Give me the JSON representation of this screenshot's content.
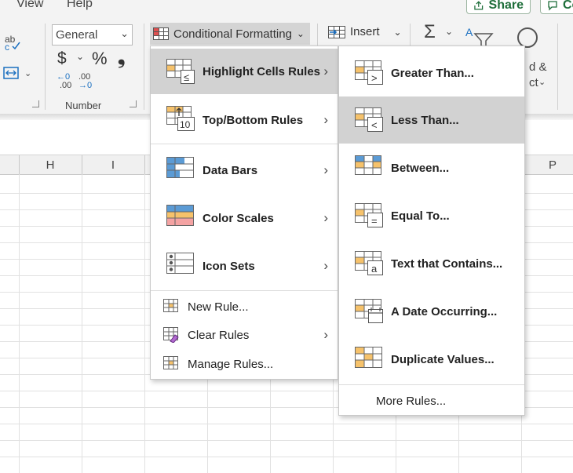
{
  "menubar": {
    "view_label": "View",
    "help_label": "Help",
    "share_label": "Share",
    "comments_partial": "Co"
  },
  "ribbon": {
    "number_format": "General",
    "currency_symbol": "$",
    "percent_symbol": "%",
    "comma_symbol": "❟",
    "increase_decimal_top": "←0",
    "increase_decimal_bottom": ".00",
    "decrease_decimal_top": ".00",
    "decrease_decimal_bottom": "→0",
    "number_group_label": "Number",
    "conditional_formatting_label": "Conditional Formatting",
    "insert_label": "Insert",
    "find_select_partial_1": "d &",
    "find_select_partial_2": "ct"
  },
  "sheet": {
    "columns": [
      "H",
      "I",
      "P"
    ]
  },
  "main_menu": {
    "items": [
      {
        "label": "Highlight Cells Rules",
        "icon": "highlight-cells-icon",
        "has_submenu": true,
        "highlighted": true
      },
      {
        "label": "Top/Bottom Rules",
        "icon": "top-bottom-icon",
        "has_submenu": true
      },
      {
        "label": "Data Bars",
        "icon": "data-bars-icon",
        "has_submenu": true
      },
      {
        "label": "Color Scales",
        "icon": "color-scales-icon",
        "has_submenu": true
      },
      {
        "label": "Icon Sets",
        "icon": "icon-sets-icon",
        "has_submenu": true
      }
    ],
    "actions": [
      {
        "label": "New Rule...",
        "icon": "new-rule-icon"
      },
      {
        "label": "Clear Rules",
        "icon": "clear-rules-icon",
        "has_submenu": true
      },
      {
        "label": "Manage Rules...",
        "icon": "manage-rules-icon"
      }
    ]
  },
  "sub_menu": {
    "items": [
      {
        "label": "Greater Than...",
        "icon": "greater-than-icon",
        "symbol": ">"
      },
      {
        "label": "Less Than...",
        "icon": "less-than-icon",
        "symbol": "<",
        "highlighted": true
      },
      {
        "label": "Between...",
        "icon": "between-icon",
        "symbol": ""
      },
      {
        "label": "Equal To...",
        "icon": "equal-to-icon",
        "symbol": "="
      },
      {
        "label": "Text that Contains...",
        "icon": "text-contains-icon",
        "symbol": "a"
      },
      {
        "label": "A Date Occurring...",
        "icon": "date-occurring-icon",
        "symbol": ""
      },
      {
        "label": "Duplicate Values...",
        "icon": "duplicate-values-icon",
        "symbol": ""
      }
    ],
    "more_rules_label": "More Rules..."
  },
  "colors": {
    "ribbon_bg": "#f3f3f3",
    "menu_highlight": "#d2d2d2",
    "icon_orange": "#f6c26b",
    "icon_blue": "#5b9bd5",
    "icon_red": "#f4a3a3",
    "accent_green": "#1e6e3a"
  }
}
